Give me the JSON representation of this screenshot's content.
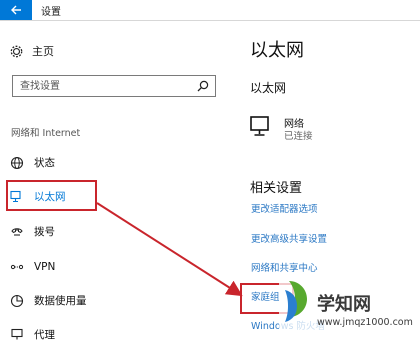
{
  "window": {
    "title": "设置"
  },
  "sidebar": {
    "home_label": "主页",
    "search_placeholder": "查找设置",
    "section_label": "网络和 Internet",
    "items": [
      {
        "label": "状态",
        "icon": "globe-icon"
      },
      {
        "label": "以太网",
        "icon": "ethernet-icon",
        "selected": true
      },
      {
        "label": "拨号",
        "icon": "dialup-icon"
      },
      {
        "label": "VPN",
        "icon": "vpn-icon"
      },
      {
        "label": "数据使用量",
        "icon": "data-usage-icon"
      },
      {
        "label": "代理",
        "icon": "proxy-icon"
      }
    ]
  },
  "main": {
    "title": "以太网",
    "subtitle": "以太网",
    "network": {
      "name": "网络",
      "status": "已连接",
      "icon": "ethernet-icon"
    },
    "related_title": "相关设置",
    "links": [
      "更改适配器选项",
      "更改高级共享设置",
      "网络和共享中心",
      "家庭组",
      "Windows 防火墙"
    ]
  },
  "watermark": {
    "text": "学知网",
    "url": "www.jmqz1000.com"
  },
  "colors": {
    "accent": "#0078d7",
    "link": "#2b78c4",
    "highlight": "#c9252c"
  }
}
